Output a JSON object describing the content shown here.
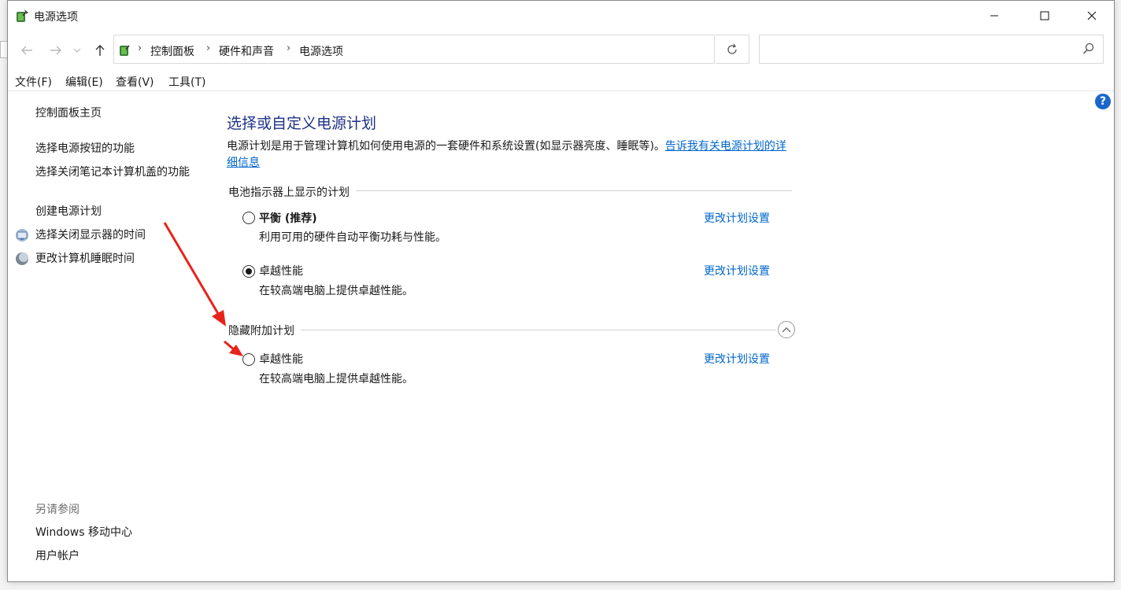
{
  "window": {
    "title": "电源选项"
  },
  "nav": {
    "breadcrumbs": [
      "控制面板",
      "硬件和声音",
      "电源选项"
    ],
    "search_placeholder": ""
  },
  "menu": [
    "文件(F)",
    "编辑(E)",
    "查看(V)",
    "工具(T)"
  ],
  "sidebar": {
    "home": "控制面板主页",
    "links": [
      {
        "label": "选择电源按钮的功能",
        "icon": "none"
      },
      {
        "label": "选择关闭笔记本计算机盖的功能",
        "icon": "none"
      },
      {
        "label": "创建电源计划",
        "icon": "none"
      },
      {
        "label": "选择关闭显示器的时间",
        "icon": "monitor-icon"
      },
      {
        "label": "更改计算机睡眠时间",
        "icon": "moon-icon"
      }
    ],
    "see_also_title": "另请参阅",
    "see_also": [
      "Windows 移动中心",
      "用户帐户"
    ]
  },
  "main": {
    "title": "选择或自定义电源计划",
    "description": "电源计划是用于管理计算机如何使用电源的一套硬件和系统设置(如显示器亮度、睡眠等)。",
    "description_link": "告诉我有关电源计划的详细信息",
    "group_battery": "电池指示器上显示的计划",
    "group_hidden": "隐藏附加计划",
    "plans": [
      {
        "name": "平衡 (推荐)",
        "desc": "利用可用的硬件自动平衡功耗与性能。",
        "link": "更改计划设置",
        "selected": false
      },
      {
        "name": "卓越性能",
        "desc": "在较高端电脑上提供卓越性能。",
        "link": "更改计划设置",
        "selected": true
      },
      {
        "name": "卓越性能",
        "desc": "在较高端电脑上提供卓越性能。",
        "link": "更改计划设置",
        "selected": false
      }
    ]
  },
  "colors": {
    "title_blue": "#1e3287",
    "link_blue": "#0066cc",
    "annotation_red": "#e8231b"
  }
}
